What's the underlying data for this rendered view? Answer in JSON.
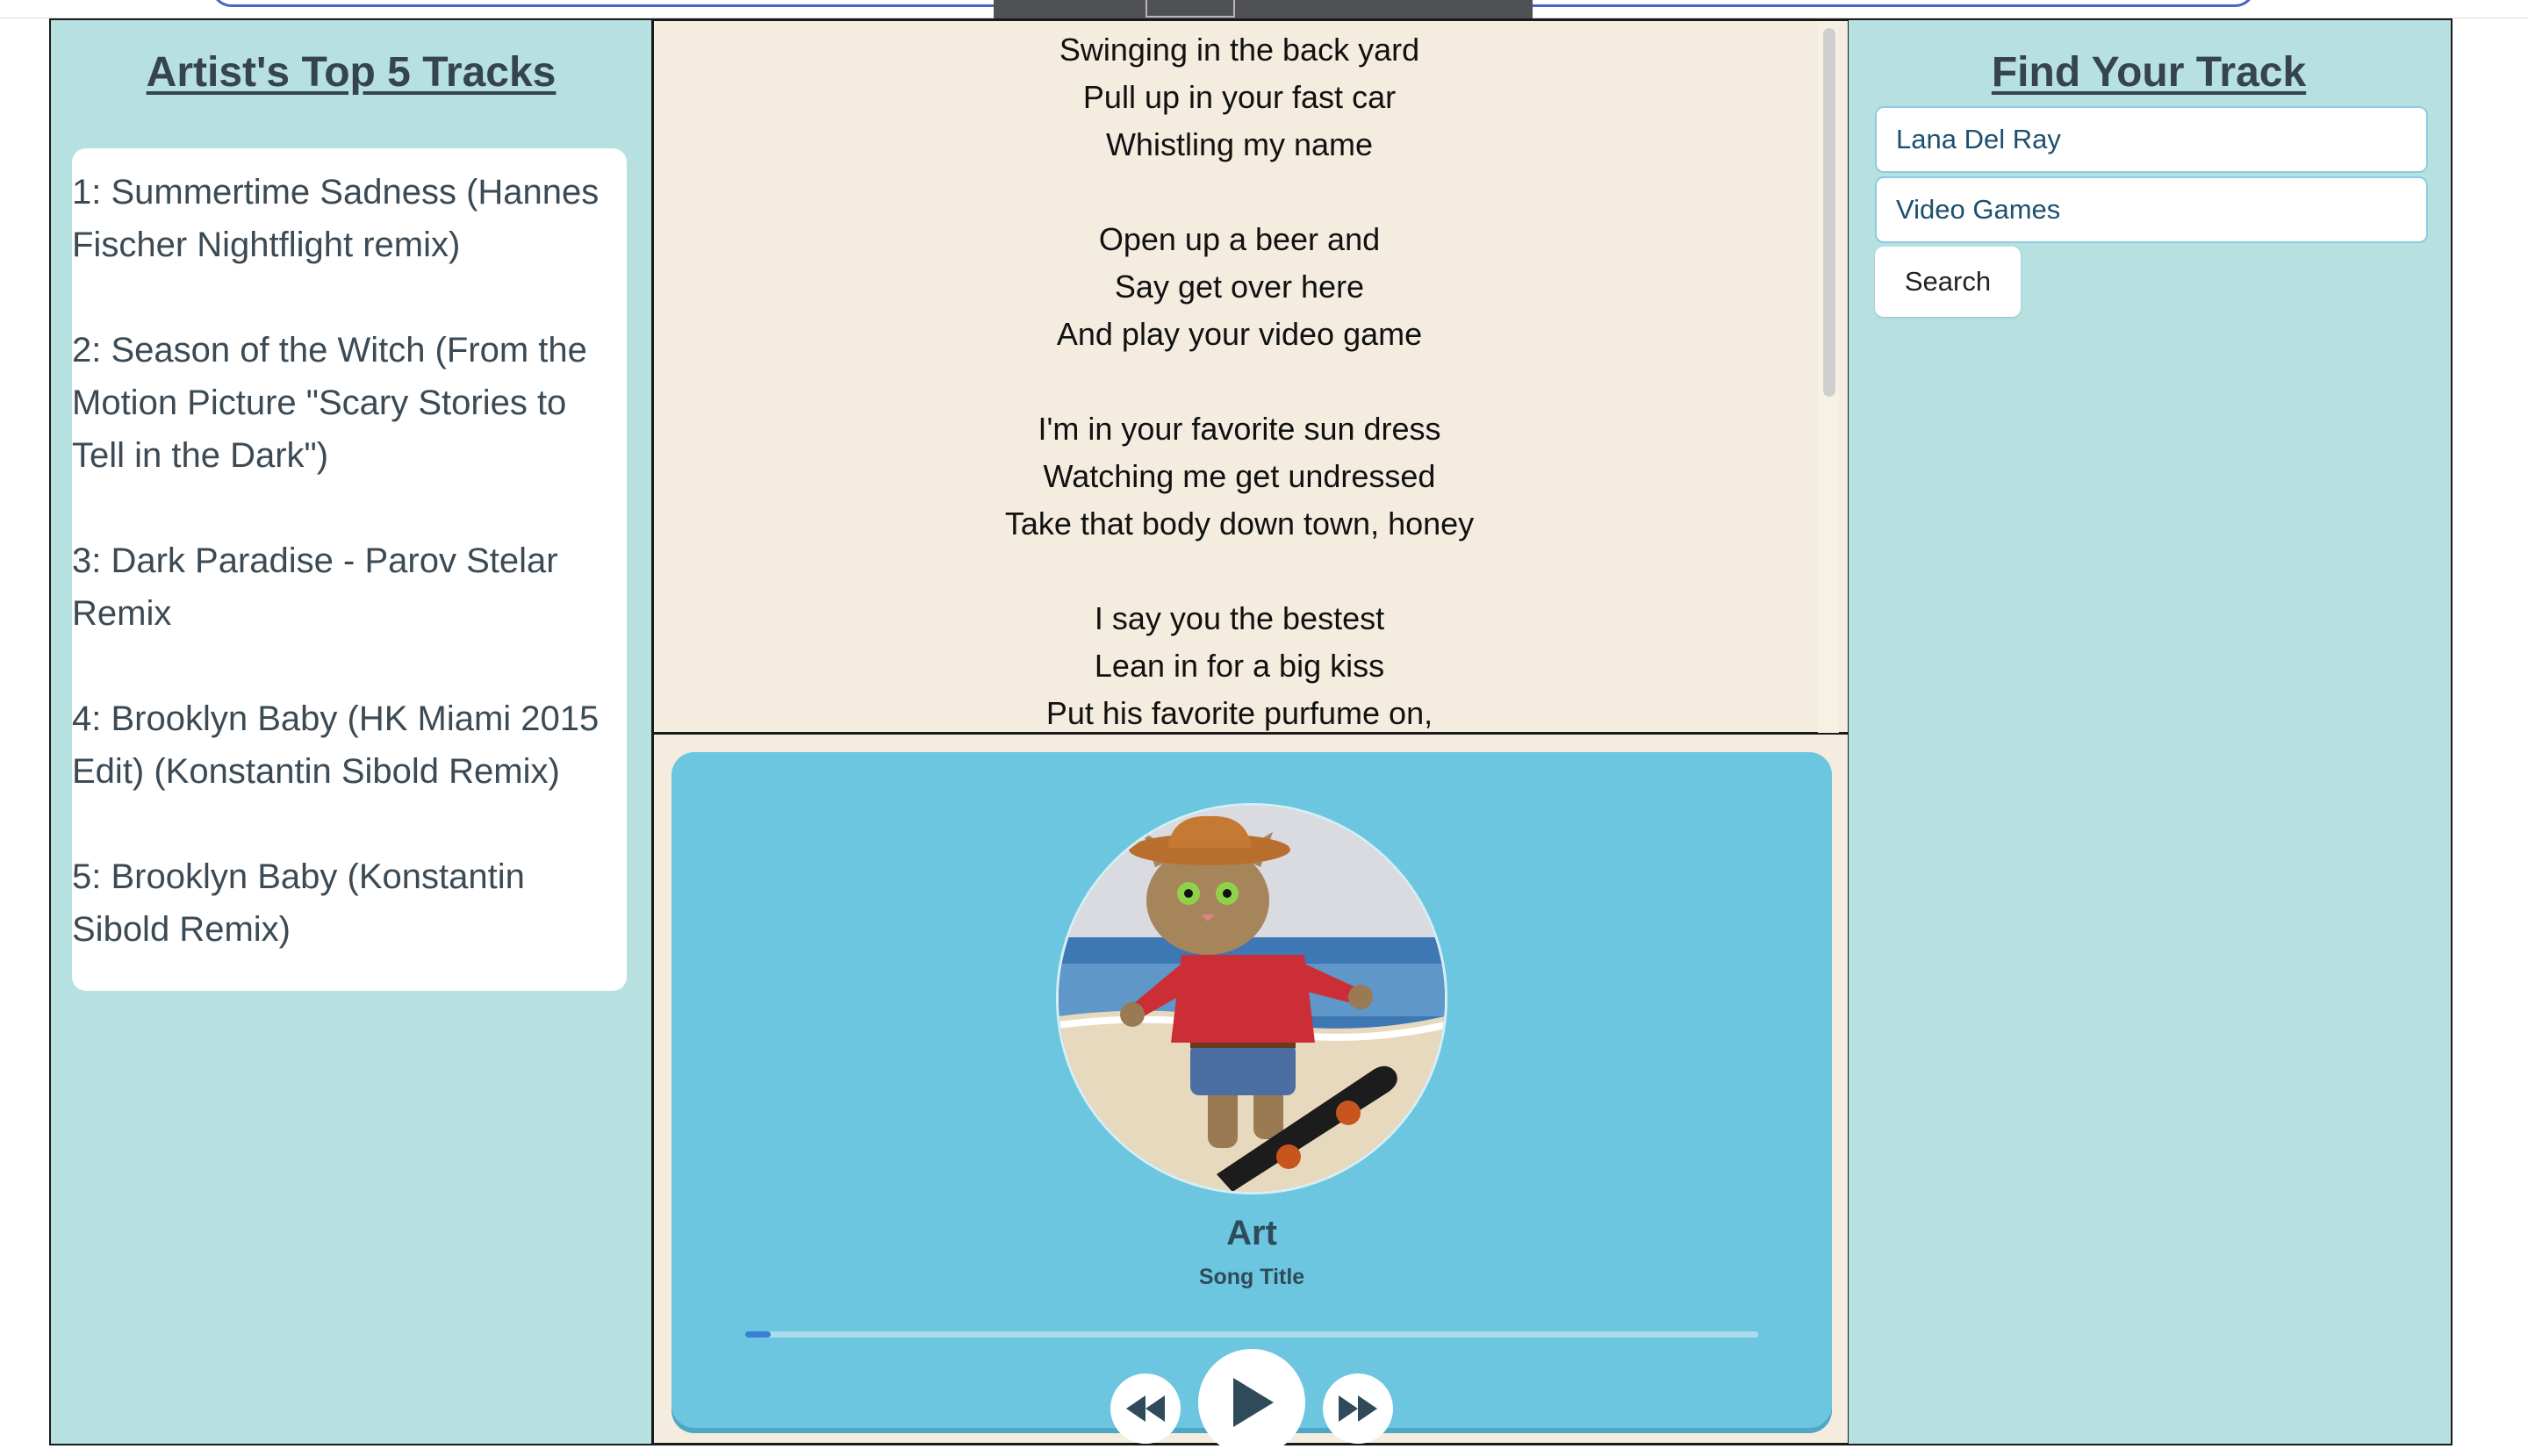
{
  "top_tracks": {
    "heading": "Artist's Top 5 Tracks",
    "items": [
      {
        "label": "1: Summertime Sadness (Hannes Fischer Nightflight remix)"
      },
      {
        "label": "2: Season of the Witch (From the Motion Picture \"Scary Stories to Tell in the Dark\")"
      },
      {
        "label": "3: Dark Paradise - Parov Stelar Remix"
      },
      {
        "label": "4: Brooklyn Baby (HK Miami 2015 Edit) (Konstantin Sibold Remix)"
      },
      {
        "label": "5: Brooklyn Baby (Konstantin Sibold Remix)"
      }
    ]
  },
  "lyrics": {
    "lines": [
      "Swinging in the back yard",
      "Pull up in your fast car",
      "Whistling my name",
      "",
      "Open up a beer and",
      "Say get over here",
      "And play your video game",
      "",
      "I'm in your favorite sun dress",
      "Watching me get undressed",
      "Take that body down town, honey",
      "",
      "I say you the bestest",
      "Lean in for a big kiss",
      "Put his favorite purfume on,"
    ]
  },
  "player": {
    "art_alt": "cat-on-skateboard-artwork",
    "song_name": "Art",
    "song_subtitle": "Song Title",
    "progress": 0.025,
    "controls": {
      "rewind_icon": "rewind-icon",
      "play_icon": "play-icon",
      "forward_icon": "fast-forward-icon"
    },
    "colors": {
      "card": "#6cc6e0",
      "progress_fill": "#3a7fd6"
    }
  },
  "search": {
    "heading": "Find Your Track",
    "artist_value": "Lana Del Ray",
    "track_value": "Video Games",
    "button_label": "Search"
  }
}
